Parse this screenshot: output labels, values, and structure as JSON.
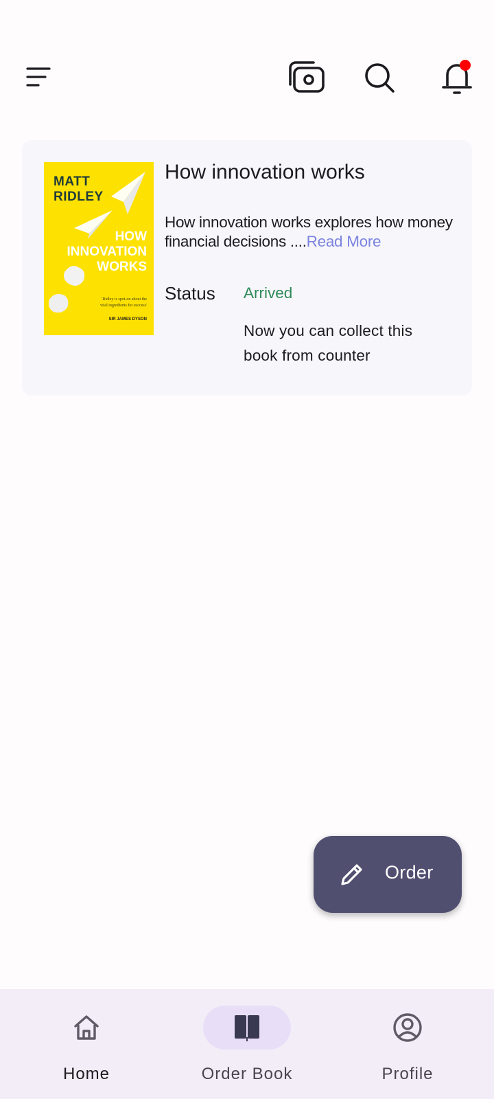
{
  "top_bar": {
    "menu_icon": "menu-icon",
    "actions": [
      "camera-switch-icon",
      "search-icon",
      "notification-bell-icon"
    ],
    "notification_dot_color": "#ff0000"
  },
  "order_card": {
    "cover": {
      "author": "MATT RIDLEY",
      "title": "HOW INNOVATION WORKS",
      "quote": "'Ridley is spot-on about the vital ingredients for success'",
      "quote_author": "SIR JAMES DYSON",
      "background_color": "#fde100"
    },
    "title": "How innovation works",
    "description": "How innovation works explores how money financial decisions ....",
    "read_more": "Read More",
    "status_label": "Status",
    "status_value": "Arrived",
    "status_note": "Now you can collect this book from counter",
    "status_color": "#2e8b57"
  },
  "fab": {
    "label": "Order",
    "icon": "pencil-icon",
    "background_color": "#514f70"
  },
  "bottom_nav": {
    "items": [
      {
        "label": "Home",
        "icon": "home-icon"
      },
      {
        "label": "Order Book",
        "icon": "book-icon",
        "active": true
      },
      {
        "label": "Profile",
        "icon": "profile-icon"
      }
    ],
    "active_pill_color": "#e8def8"
  }
}
